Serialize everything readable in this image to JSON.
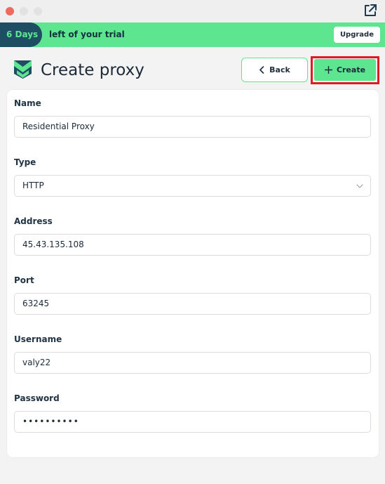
{
  "window": {
    "external_link_icon": "external-link-icon"
  },
  "banner": {
    "days": "6 Days",
    "text": "left of your trial",
    "upgrade_label": "Upgrade",
    "accent_color": "#5ee590",
    "pill_color": "#1e4e63"
  },
  "header": {
    "title": "Create proxy",
    "back_label": "Back",
    "create_label": "Create",
    "highlight_color": "#e01b22"
  },
  "form": {
    "name_label": "Name",
    "name_value": "Residential Proxy",
    "type_label": "Type",
    "type_value": "HTTP",
    "address_label": "Address",
    "address_value": "45.43.135.108",
    "port_label": "Port",
    "port_value": "63245",
    "username_label": "Username",
    "username_value": "valy22",
    "password_label": "Password",
    "password_value": "••••••••••"
  }
}
